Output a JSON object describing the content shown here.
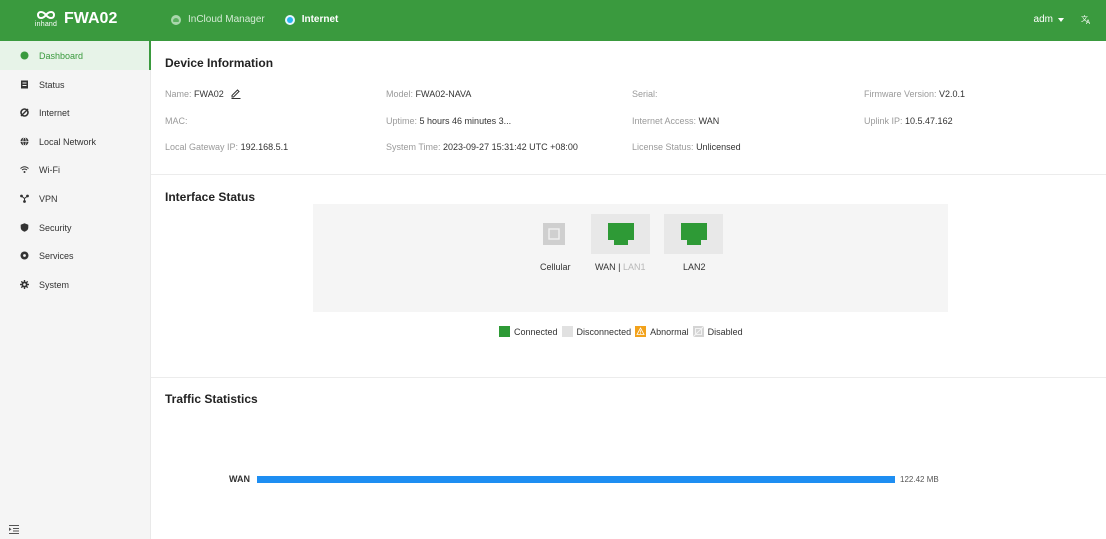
{
  "header": {
    "brand_name": "FWA02",
    "brand_sub": "inhand",
    "nav": [
      {
        "label": "InCloud Manager",
        "icon": "cloud-icon",
        "active": false
      },
      {
        "label": "Internet",
        "icon": "internet-dot-icon",
        "active": true
      }
    ],
    "user": "adm",
    "language_icon": "translate-icon"
  },
  "sidebar": {
    "items": [
      {
        "label": "Dashboard",
        "icon": "dashboard-icon",
        "active": true
      },
      {
        "label": "Status",
        "icon": "status-icon",
        "active": false
      },
      {
        "label": "Internet",
        "icon": "internet-icon",
        "active": false
      },
      {
        "label": "Local Network",
        "icon": "globe-icon",
        "active": false
      },
      {
        "label": "Wi-Fi",
        "icon": "wifi-icon",
        "active": false
      },
      {
        "label": "VPN",
        "icon": "vpn-icon",
        "active": false
      },
      {
        "label": "Security",
        "icon": "shield-icon",
        "active": false
      },
      {
        "label": "Services",
        "icon": "services-icon",
        "active": false
      },
      {
        "label": "System",
        "icon": "gear-icon",
        "active": false
      }
    ],
    "collapse_icon": "collapse-icon"
  },
  "device_info": {
    "title": "Device Information",
    "fields": {
      "name": {
        "label": "Name:",
        "value": "FWA02"
      },
      "model": {
        "label": "Model:",
        "value": "FWA02-NAVA"
      },
      "serial": {
        "label": "Serial:",
        "value": ""
      },
      "firmware": {
        "label": "Firmware Version:",
        "value": "V2.0.1"
      },
      "mac": {
        "label": "MAC:",
        "value": ""
      },
      "uptime": {
        "label": "Uptime:",
        "value": "5 hours 46 minutes 3..."
      },
      "internet_access": {
        "label": "Internet Access:",
        "value": "WAN"
      },
      "uplink_ip": {
        "label": "Uplink IP:",
        "value": "10.5.47.162"
      },
      "gateway_ip": {
        "label": "Local Gateway IP:",
        "value": "192.168.5.1"
      },
      "system_time": {
        "label": "System Time:",
        "value": "2023-09-27 15:31:42 UTC +08:00"
      },
      "license": {
        "label": "License Status:",
        "value": "Unlicensed"
      }
    }
  },
  "interface_status": {
    "title": "Interface Status",
    "ports": [
      {
        "label": "Cellular",
        "state": "disabled"
      },
      {
        "label_primary": "WAN",
        "label_sep": " | ",
        "label_secondary": "LAN1",
        "state": "connected"
      },
      {
        "label": "LAN2",
        "state": "connected"
      }
    ],
    "legend": [
      {
        "label": "Connected",
        "color": "#2e9a36"
      },
      {
        "label": "Disconnected",
        "color": "#e1e1e1"
      },
      {
        "label": "Abnormal",
        "color": "#f2a21b"
      },
      {
        "label": "Disabled",
        "color": "#c9c9c9"
      }
    ]
  },
  "traffic": {
    "title": "Traffic Statistics",
    "rows": [
      {
        "label": "WAN",
        "value": "122.42 MB",
        "fraction": 1.0,
        "color": "#1e8ef2"
      }
    ]
  }
}
